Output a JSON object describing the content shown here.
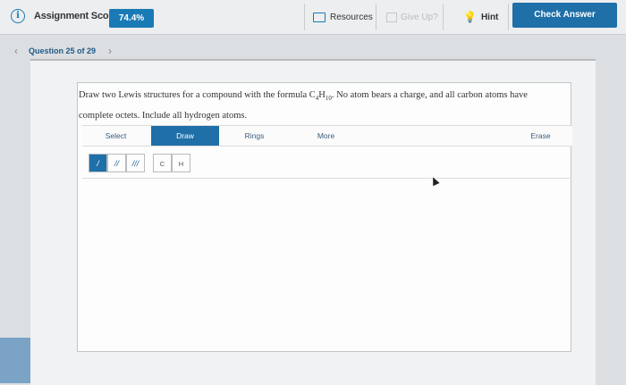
{
  "header": {
    "score_label": "Assignment Score:",
    "score_value": "74.4%",
    "resources_label": "Resources",
    "giveup_label": "Give Up?",
    "hint_label": "Hint",
    "check_label": "Check Answer"
  },
  "question_nav": {
    "text": "Question 25 of 29",
    "prev": "‹",
    "next": "›"
  },
  "prompt": {
    "part1": "Draw two Lewis structures for a compound with the formula C",
    "sub1": "4",
    "part2": "H",
    "sub2": "10",
    "part3": ". No atom bears a charge, and all carbon atoms have",
    "line2": "complete octets. Include all hydrogen atoms."
  },
  "toolbar": {
    "select": "Select",
    "draw": "Draw",
    "rings": "Rings",
    "more": "More",
    "erase": "Erase"
  },
  "bonds": [
    "/",
    "//",
    "///"
  ],
  "atoms": [
    "C",
    "H"
  ],
  "colors": {
    "accent": "#1f6fa8",
    "score_bg": "#1a7ab5"
  },
  "icons": [
    "info-icon",
    "folder-icon",
    "flag-icon",
    "lightbulb-icon",
    "chevron-left-icon",
    "chevron-right-icon"
  ]
}
